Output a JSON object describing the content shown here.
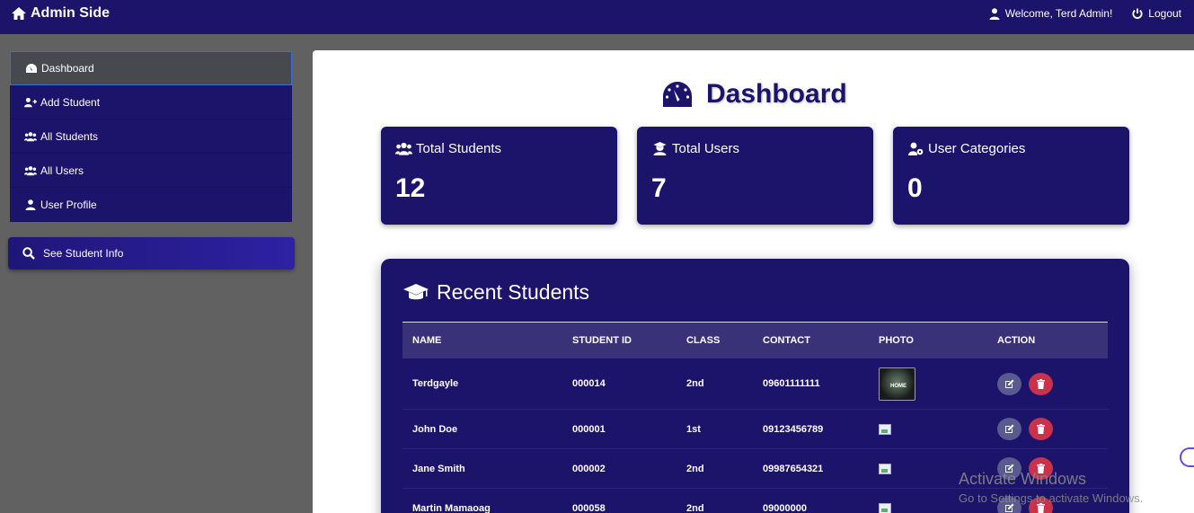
{
  "topbar": {
    "brand": "Admin Side",
    "welcome": "Welcome, Terd Admin!",
    "logout": "Logout"
  },
  "sidebar": {
    "items": [
      {
        "label": "Dashboard",
        "icon": "gauge-icon"
      },
      {
        "label": "Add Student",
        "icon": "user-plus-icon"
      },
      {
        "label": "All Students",
        "icon": "users-icon"
      },
      {
        "label": "All Users",
        "icon": "users-icon"
      },
      {
        "label": "User Profile",
        "icon": "user-icon"
      }
    ],
    "see_info": "See Student Info"
  },
  "main": {
    "title": "Dashboard",
    "cards": [
      {
        "label": "Total Students",
        "value": "12",
        "icon": "users-icon"
      },
      {
        "label": "Total Users",
        "value": "7",
        "icon": "user-graduate-icon"
      },
      {
        "label": "User Categories",
        "value": "0",
        "icon": "user-gear-icon"
      }
    ],
    "recent": {
      "title": "Recent Students",
      "columns": [
        "NAME",
        "STUDENT ID",
        "CLASS",
        "CONTACT",
        "PHOTO",
        "ACTION"
      ],
      "rows": [
        {
          "name": "Terdgayle",
          "id": "000014",
          "class": "2nd",
          "contact": "09601111111",
          "photo_label": "HOME"
        },
        {
          "name": "John Doe",
          "id": "000001",
          "class": "1st",
          "contact": "09123456789"
        },
        {
          "name": "Jane Smith",
          "id": "000002",
          "class": "2nd",
          "contact": "09987654321"
        },
        {
          "name": "Martin Mamaoag",
          "id": "000058",
          "class": "2nd",
          "contact": "09000000"
        }
      ]
    }
  },
  "watermark": {
    "line1": "Activate Windows",
    "line2": "Go to Settings to activate Windows."
  },
  "colors": {
    "navy": "#1c136a",
    "delete": "#c8324a",
    "edit": "#595a90"
  }
}
